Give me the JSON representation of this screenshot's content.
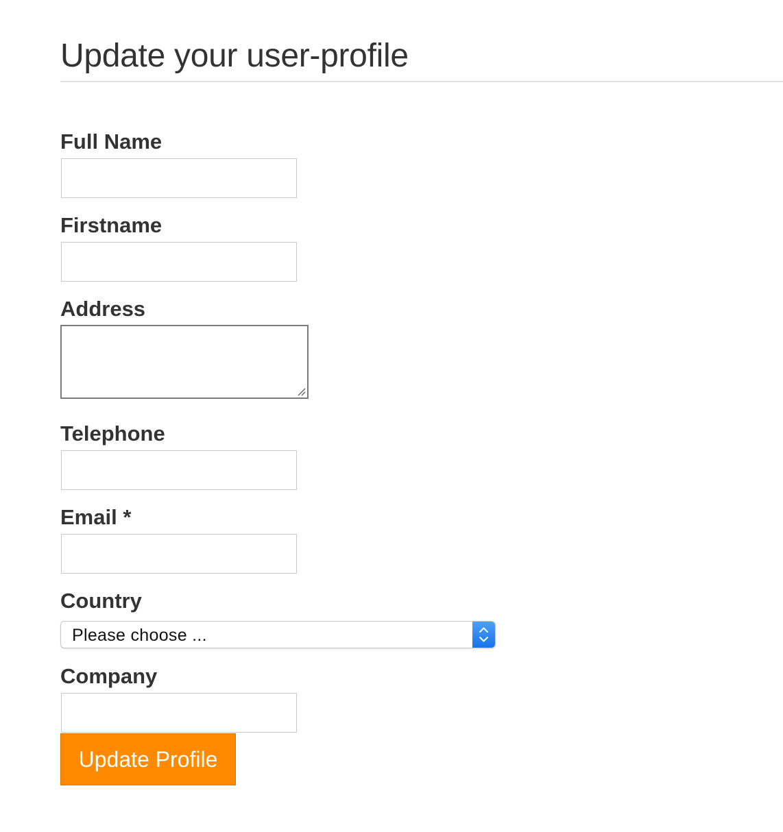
{
  "page": {
    "title": "Update your user-profile"
  },
  "form": {
    "full_name": {
      "label": "Full Name",
      "value": ""
    },
    "firstname": {
      "label": "Firstname",
      "value": ""
    },
    "address": {
      "label": "Address",
      "value": ""
    },
    "telephone": {
      "label": "Telephone",
      "value": ""
    },
    "email": {
      "label": "Email *",
      "value": ""
    },
    "country": {
      "label": "Country",
      "selected": "Please choose ..."
    },
    "company": {
      "label": "Company",
      "value": ""
    },
    "submit_label": "Update Profile"
  },
  "colors": {
    "accent": "#ff8a00",
    "select_stepper": "#1a73e8",
    "text": "#333333"
  },
  "icons": {
    "select_stepper": "chevron-up-down-icon",
    "textarea_grip": "resize-grip-icon"
  }
}
